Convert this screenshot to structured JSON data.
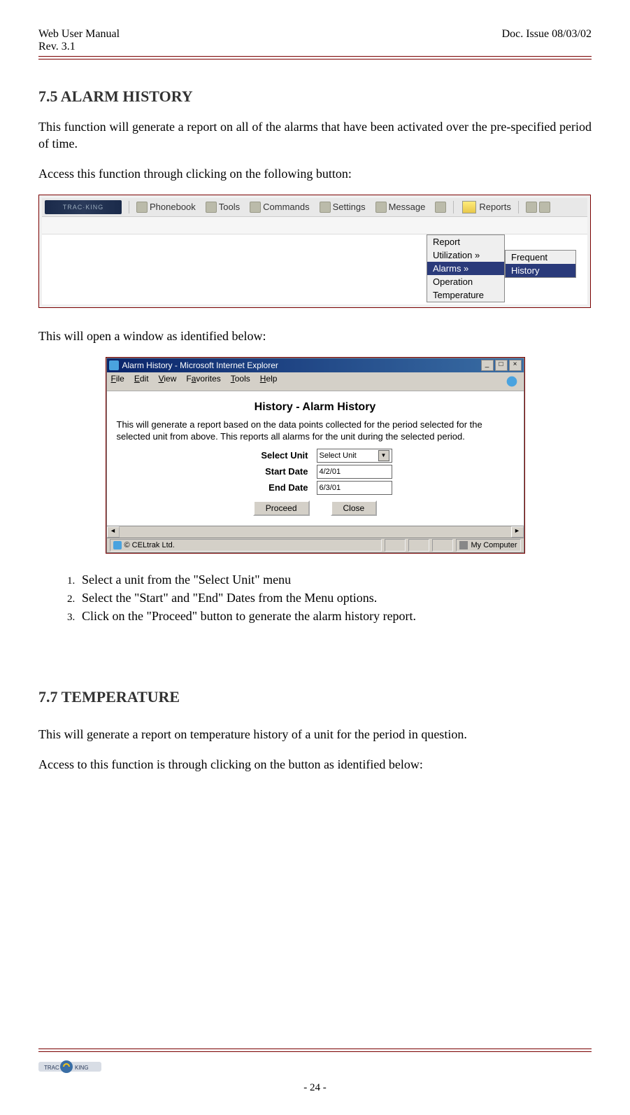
{
  "header": {
    "left_line1": "Web User Manual",
    "left_line2": "Rev. 3.1",
    "right_line1": "Doc. Issue 08/03/02"
  },
  "section1": {
    "number": "7.5",
    "title_rest": "ALARM HISTORY",
    "para1": "This function will generate a report on all of the alarms that have been activated over the pre-specified period of time.",
    "para2": "Access this function through clicking on the following button:"
  },
  "toolbar": {
    "logo_text": "TRAC·KING",
    "items": [
      "Phonebook",
      "Tools",
      "Commands",
      "Settings",
      "Message",
      "Reports"
    ]
  },
  "menu1": {
    "items": [
      "Report",
      "Utilization  »",
      "Alarms  »",
      "Operation",
      "Temperature"
    ],
    "selected_index": 2
  },
  "menu2": {
    "items": [
      "Frequent",
      "History"
    ],
    "selected_index": 1
  },
  "mid_para": "This will open a window as identified below:",
  "ie_window": {
    "title": "Alarm History - Microsoft Internet Explorer",
    "menus": [
      "File",
      "Edit",
      "View",
      "Favorites",
      "Tools",
      "Help"
    ],
    "heading": "History - Alarm History",
    "desc": "This will generate a report based on the data points collected for the period selected for the selected unit from above. This reports all alarms for the unit during the selected period.",
    "select_unit_label": "Select Unit",
    "select_unit_value": "Select Unit",
    "start_date_label": "Start Date",
    "start_date_value": "4/2/01",
    "end_date_label": "End Date",
    "end_date_value": "6/3/01",
    "proceed": "Proceed",
    "close": "Close",
    "status_left": "© CELtrak Ltd.",
    "status_right": "My Computer"
  },
  "steps": [
    "Select a unit from the \"Select Unit\" menu",
    "Select the \"Start\" and \"End\" Dates from the Menu options.",
    "Click on the \"Proceed\" button to generate the alarm history report."
  ],
  "section2": {
    "number": "7.7",
    "title_rest": "TEMPERATURE",
    "para1": "This will generate a report on temperature history of a unit for the period in question.",
    "para2": "Access to this function is through clicking on the button as identified below:"
  },
  "footer": {
    "page": "- 24 -"
  }
}
